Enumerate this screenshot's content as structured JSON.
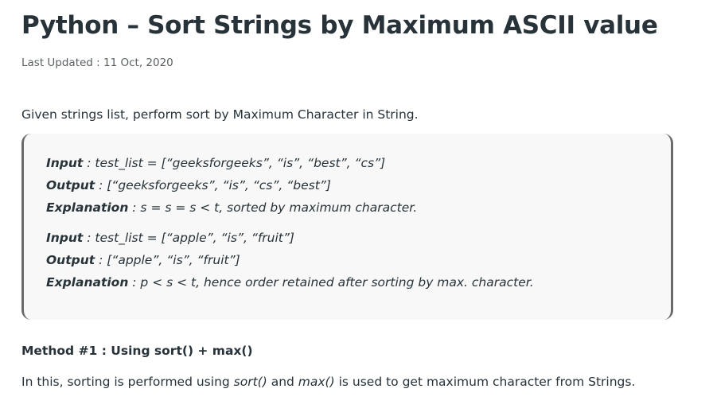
{
  "article": {
    "title": "Python – Sort Strings by Maximum ASCII value",
    "last_updated": "Last Updated : 11 Oct, 2020",
    "intro": "Given strings list, perform sort by Maximum Character in String.",
    "examples": [
      {
        "input_label": "Input",
        "input": " : test_list = [“geeksforgeeks”, “is”, “best”, “cs”]",
        "output_label": "Output",
        "output": " : [“geeksforgeeks”, “is”, “cs”, “best”]",
        "explanation_label": "Explanation",
        "explanation": " : s = s = s < t, sorted by maximum character."
      },
      {
        "input_label": "Input",
        "input": " : test_list = [“apple”, “is”, “fruit”]",
        "output_label": "Output",
        "output": " : [“apple”, “is”, “fruit”]",
        "explanation_label": "Explanation",
        "explanation": " : p < s < t, hence order retained after sorting by max. character."
      }
    ],
    "method_heading": "Method #1 : Using sort() + max()",
    "method_text": {
      "part1": "In this, sorting is performed using ",
      "code1": "sort()",
      "part2": " and ",
      "code2": "max()",
      "part3": " is used to get maximum character from Strings."
    }
  }
}
